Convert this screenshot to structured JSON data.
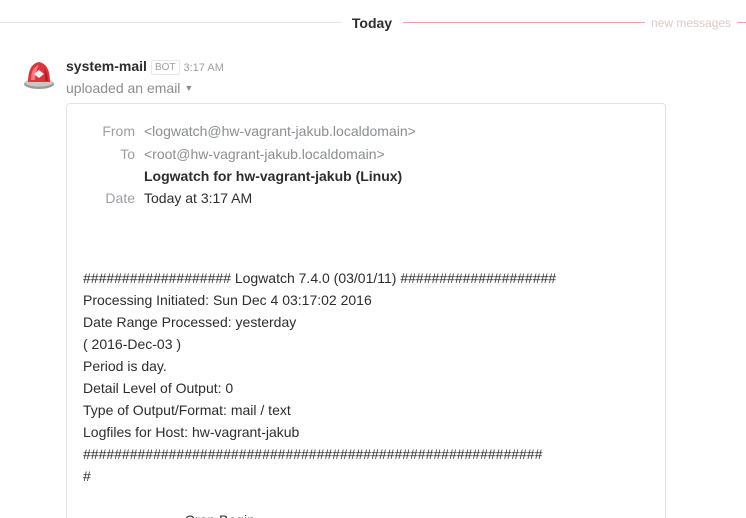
{
  "divider": {
    "date_label": "Today",
    "new_messages_label": "new messages"
  },
  "message": {
    "sender": "system-mail",
    "badge": "BOT",
    "time": "3:17 AM",
    "action": "uploaded an email",
    "avatar_icon": "red-siren-icon"
  },
  "email": {
    "from_key": "From",
    "from_value": "<logwatch@hw-vagrant-jakub.localdomain>",
    "to_key": "To",
    "to_value": "<root@hw-vagrant-jakub.localdomain>",
    "subject": "Logwatch for hw-vagrant-jakub (Linux)",
    "date_key": "Date",
    "date_value": "Today at 3:17 AM",
    "body_lines": [
      "",
      "################### Logwatch 7.4.0 (03/01/11) ####################",
      "Processing Initiated: Sun Dec 4 03:17:02 2016",
      "Date Range Processed: yesterday",
      "( 2016-Dec-03 )",
      "Period is day.",
      "Detail Level of Output: 0",
      "Type of Output/Format: mail / text",
      "Logfiles for Host: hw-vagrant-jakub",
      "###########################################################",
      "#",
      "",
      "--------------------- Cron Begin ------------------------"
    ]
  },
  "colors": {
    "accent_red": "#d9363e",
    "new_messages_line": "#e8a0a0",
    "text_primary": "#2c2d30",
    "text_muted": "#9e9ea6"
  }
}
